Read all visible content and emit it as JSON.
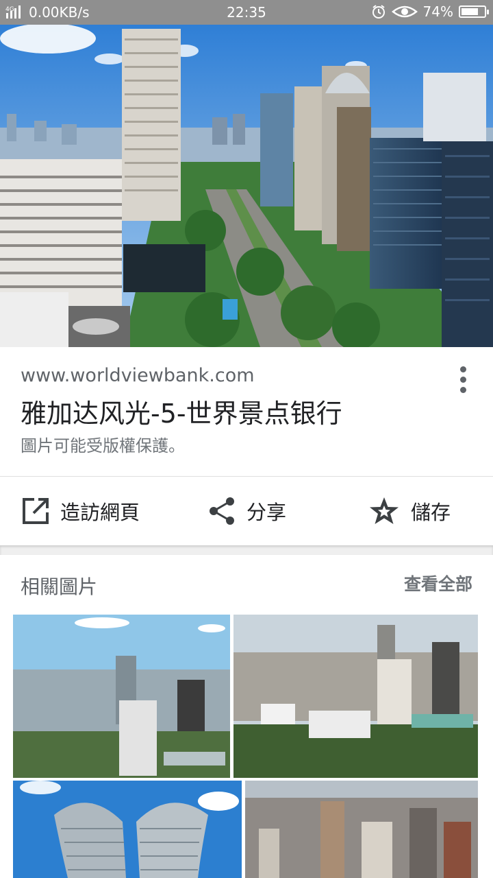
{
  "status_bar": {
    "network": "4G",
    "speed": "0.00KB/s",
    "time": "22:35",
    "battery": "74%",
    "battery_level": 0.74
  },
  "result": {
    "url": "www.worldviewbank.com",
    "title": "雅加达风光-5-世界景点银行",
    "copyright_notice": "圖片可能受版權保護。"
  },
  "actions": {
    "visit": "造訪網頁",
    "share": "分享",
    "save": "儲存"
  },
  "related": {
    "heading": "相關圖片",
    "see_all": "查看全部"
  }
}
